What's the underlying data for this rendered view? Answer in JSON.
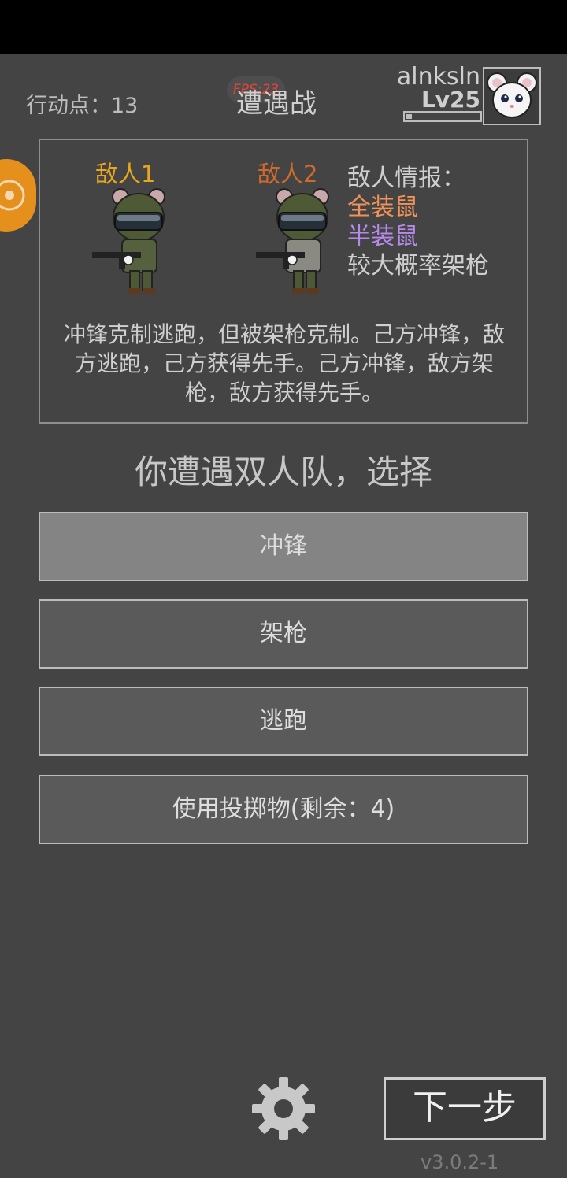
{
  "header": {
    "action_points": "行动点：13",
    "fps": "FPS:23",
    "title": "遭遇战",
    "username": "alnksln",
    "level": "Lv25",
    "xp_fraction": 0.08
  },
  "enemy_panel": {
    "enemy1_label": "敌人1",
    "enemy2_label": "敌人2",
    "intel_title": "敌人情报：",
    "intel_full_armor": "全装鼠",
    "intel_half_armor": "半装鼠",
    "intel_note": "较大概率架枪",
    "description": "冲锋克制逃跑，但被架枪克制。己方冲锋，敌方逃跑，己方获得先手。己方冲锋，敌方架枪，敌方获得先手。",
    "colors": {
      "enemy1": "#e8a51e",
      "enemy2": "#d06a2a",
      "full": "#f0935a",
      "half": "#b58aea"
    }
  },
  "prompt": "你遭遇双人队，选择",
  "actions": {
    "charge": "冲锋",
    "ambush": "架枪",
    "flee": "逃跑",
    "throwable": "使用投掷物(剩余：4)"
  },
  "footer": {
    "next": "下一步",
    "version": "v3.0.2-1",
    "settings_icon": "gear-icon"
  }
}
